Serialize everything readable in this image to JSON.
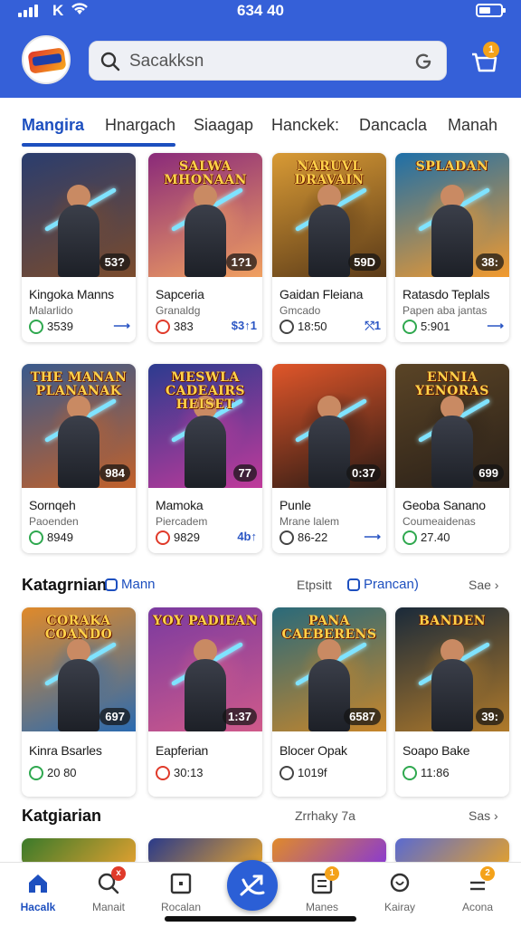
{
  "status": {
    "carrier": "K",
    "time": "634 40"
  },
  "search": {
    "placeholder": "Sacakksn"
  },
  "cart": {
    "badge": "1"
  },
  "tabs": [
    "Mangira",
    "Hnargach",
    "Siaagap",
    "Hanckek:",
    "Dancacla",
    "Manah"
  ],
  "row1": [
    {
      "art_title": "",
      "score": "53?",
      "name": "Kingoka Manns",
      "sub": "Malarlido",
      "meta": "3539",
      "action": "⟶",
      "colors": [
        "#2a3d6e",
        "#7b4b2c"
      ]
    },
    {
      "art_title": "Salwa Mhonaan",
      "score": "1?1",
      "name": "Sapceria",
      "sub": "Granaldg",
      "meta": "383",
      "action": "$3↑1",
      "colors": [
        "#8a2a7a",
        "#f0a060"
      ]
    },
    {
      "art_title": "Naruvl Dravain",
      "score": "59D",
      "name": "Gaidan Fleiana",
      "sub": "Gmcado",
      "meta": "18:50",
      "action": "⤲1",
      "colors": [
        "#d89a35",
        "#5a3a18"
      ]
    },
    {
      "art_title": "Spladan",
      "score": "38:",
      "name": "Ratasdo Teplals",
      "sub": "Papen aba jantas",
      "meta": "5:901",
      "action": "⟶",
      "colors": [
        "#1d6fa8",
        "#f29a2e"
      ]
    }
  ],
  "row2": [
    {
      "art_title": "The Manan Plananak",
      "score": "984",
      "name": "Sornqeh",
      "sub": "Paoenden",
      "meta": "8949",
      "action": "",
      "colors": [
        "#3a5a8c",
        "#c2612a"
      ]
    },
    {
      "art_title": "Meswla Cadeairs Heiset",
      "score": "77",
      "name": "Mamoka",
      "sub": "Piercadem",
      "meta": "9829",
      "action": "4b↑",
      "colors": [
        "#2c3b8f",
        "#c03a9a"
      ]
    },
    {
      "art_title": "",
      "score": "0:37",
      "name": "Punle",
      "sub": "Mrane lalem",
      "meta": "86-22",
      "action": "⟶",
      "colors": [
        "#e0562a",
        "#2a1a14"
      ]
    },
    {
      "art_title": "Ennia Yenoras",
      "score": "699",
      "name": "Geoba Sanano",
      "sub": "Coumeaidenas",
      "meta": "27.40",
      "action": "",
      "colors": [
        "#5a4426",
        "#2a2018"
      ]
    }
  ],
  "section1": {
    "title": "Katagrnian",
    "chip": "Mann",
    "link": "Etpsitt",
    "chip2": "Prancan)",
    "see": "Sae ›"
  },
  "row3": [
    {
      "art_title": "Coraka Coando",
      "score": "697",
      "name": "Kinra Bsarles",
      "sub": "",
      "meta": "20 80",
      "action": "",
      "colors": [
        "#e08a2a",
        "#2a6ab0"
      ]
    },
    {
      "art_title": "Yoy Padiean",
      "score": "1:37",
      "name": "Eapferian",
      "sub": "",
      "meta": "30:13",
      "action": "",
      "colors": [
        "#7a3aa0",
        "#d05a8a"
      ]
    },
    {
      "art_title": "Pana Caeberens",
      "score": "6587",
      "name": "Blocer Opak",
      "sub": "",
      "meta": "1019f",
      "action": "",
      "colors": [
        "#2a6a7a",
        "#c8862a"
      ]
    },
    {
      "art_title": "Banden",
      "score": "39:",
      "name": "Soapo Bake",
      "sub": "",
      "meta": "11:86",
      "action": "",
      "colors": [
        "#1a2a3a",
        "#b07a2a"
      ]
    }
  ],
  "section2": {
    "title": "Katgiarian",
    "link": "Zrrhaky 7a",
    "see": "Sas ›"
  },
  "nav": [
    {
      "label": "Hacalk"
    },
    {
      "label": "Manait",
      "badge": "x"
    },
    {
      "label": "Rocalan"
    },
    {
      "label": "Manes",
      "badge": "1"
    },
    {
      "label": "Kairay"
    },
    {
      "label": "Acona",
      "badge": "2"
    }
  ],
  "colors": {
    "primary": "#3560d8",
    "accent": "#1d4fbf",
    "badge": "#f4a21a"
  }
}
